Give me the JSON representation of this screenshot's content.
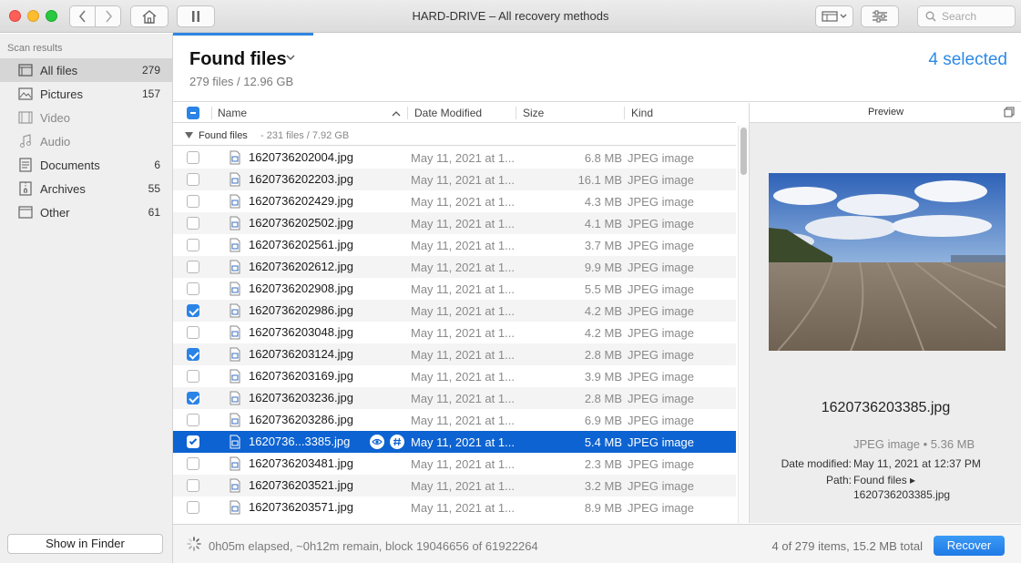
{
  "window": {
    "title": "HARD-DRIVE – All recovery methods"
  },
  "toolbar": {
    "search_placeholder": "Search"
  },
  "sidebar": {
    "heading": "Scan results",
    "items": [
      {
        "label": "All files",
        "count": "279",
        "icon": "all-files-icon"
      },
      {
        "label": "Pictures",
        "count": "157",
        "icon": "pictures-icon"
      },
      {
        "label": "Video",
        "count": "",
        "icon": "video-icon"
      },
      {
        "label": "Audio",
        "count": "",
        "icon": "audio-icon"
      },
      {
        "label": "Documents",
        "count": "6",
        "icon": "documents-icon"
      },
      {
        "label": "Archives",
        "count": "55",
        "icon": "archives-icon"
      },
      {
        "label": "Other",
        "count": "61",
        "icon": "other-icon"
      }
    ],
    "show_in_finder": "Show in Finder"
  },
  "header": {
    "title": "Found files",
    "subtitle": "279 files / 12.96 GB",
    "selected": "4 selected"
  },
  "table": {
    "columns": {
      "name": "Name",
      "date": "Date Modified",
      "size": "Size",
      "kind": "Kind"
    },
    "group": {
      "name": "Found files",
      "meta": "- 231 files / 7.92 GB"
    },
    "rows": [
      {
        "name": "1620736202004.jpg",
        "date": "May 11, 2021 at 1...",
        "size": "6.8 MB",
        "kind": "JPEG image",
        "checked": false
      },
      {
        "name": "1620736202203.jpg",
        "date": "May 11, 2021 at 1...",
        "size": "16.1 MB",
        "kind": "JPEG image",
        "checked": false
      },
      {
        "name": "1620736202429.jpg",
        "date": "May 11, 2021 at 1...",
        "size": "4.3 MB",
        "kind": "JPEG image",
        "checked": false
      },
      {
        "name": "1620736202502.jpg",
        "date": "May 11, 2021 at 1...",
        "size": "4.1 MB",
        "kind": "JPEG image",
        "checked": false
      },
      {
        "name": "1620736202561.jpg",
        "date": "May 11, 2021 at 1...",
        "size": "3.7 MB",
        "kind": "JPEG image",
        "checked": false
      },
      {
        "name": "1620736202612.jpg",
        "date": "May 11, 2021 at 1...",
        "size": "9.9 MB",
        "kind": "JPEG image",
        "checked": false
      },
      {
        "name": "1620736202908.jpg",
        "date": "May 11, 2021 at 1...",
        "size": "5.5 MB",
        "kind": "JPEG image",
        "checked": false
      },
      {
        "name": "1620736202986.jpg",
        "date": "May 11, 2021 at 1...",
        "size": "4.2 MB",
        "kind": "JPEG image",
        "checked": true
      },
      {
        "name": "1620736203048.jpg",
        "date": "May 11, 2021 at 1...",
        "size": "4.2 MB",
        "kind": "JPEG image",
        "checked": false
      },
      {
        "name": "1620736203124.jpg",
        "date": "May 11, 2021 at 1...",
        "size": "2.8 MB",
        "kind": "JPEG image",
        "checked": true
      },
      {
        "name": "1620736203169.jpg",
        "date": "May 11, 2021 at 1...",
        "size": "3.9 MB",
        "kind": "JPEG image",
        "checked": false
      },
      {
        "name": "1620736203236.jpg",
        "date": "May 11, 2021 at 1...",
        "size": "2.8 MB",
        "kind": "JPEG image",
        "checked": true
      },
      {
        "name": "1620736203286.jpg",
        "date": "May 11, 2021 at 1...",
        "size": "6.9 MB",
        "kind": "JPEG image",
        "checked": false
      },
      {
        "name": "1620736...3385.jpg",
        "date": "May 11, 2021 at 1...",
        "size": "5.4 MB",
        "kind": "JPEG image",
        "checked": true,
        "selected": true
      },
      {
        "name": "1620736203481.jpg",
        "date": "May 11, 2021 at 1...",
        "size": "2.3 MB",
        "kind": "JPEG image",
        "checked": false
      },
      {
        "name": "1620736203521.jpg",
        "date": "May 11, 2021 at 1...",
        "size": "3.2 MB",
        "kind": "JPEG image",
        "checked": false
      },
      {
        "name": "1620736203571.jpg",
        "date": "May 11, 2021 at 1...",
        "size": "8.9 MB",
        "kind": "JPEG image",
        "checked": false
      }
    ]
  },
  "preview": {
    "heading": "Preview",
    "filename": "1620736203385.jpg",
    "type_size": "JPEG image • 5.36 MB",
    "date_label": "Date modified:",
    "date_value": "May 11, 2021 at 12:37 PM",
    "path_label": "Path:",
    "path_value": "Found files ▸ 1620736203385.jpg"
  },
  "footer": {
    "elapsed": "0h05m elapsed, ~0h12m remain, block 19046656 of 61922264",
    "totals": "4 of 279 items, 15.2 MB total",
    "recover": "Recover"
  },
  "colors": {
    "accent": "#2c8ae6",
    "selection": "#0d63d1",
    "recover": "#1f7ae6"
  }
}
